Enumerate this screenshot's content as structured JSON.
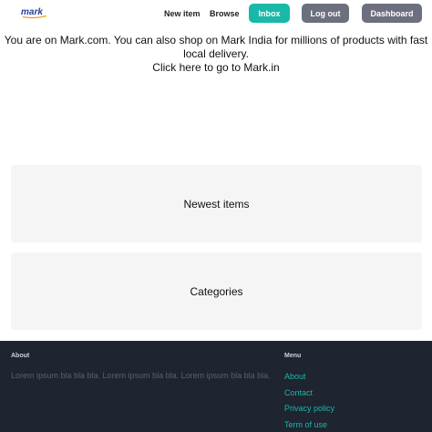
{
  "header": {
    "logo_text": "mark",
    "nav": {
      "new_item": "New item",
      "browse": "Browse"
    },
    "buttons": {
      "inbox": "Inbox",
      "logout": "Log out",
      "dashboard": "Dashboard"
    }
  },
  "notice": {
    "line1": "You are on Mark.com. You can also shop on Mark India for millions of products with fast",
    "line2": "local delivery.",
    "link": "Click here to go to Mark.in"
  },
  "sections": {
    "newest": "Newest items",
    "categories": "Categories"
  },
  "footer": {
    "about_heading": "About",
    "about_text": "Lorem ipsum bla bla bla. Lorem ipsum bla bla. Lorem ipsum bla bla bla.",
    "menu_heading": "Menu",
    "menu_items": [
      "About",
      "Contact",
      "Privacy policy",
      "Term of use"
    ]
  },
  "colors": {
    "accent": "#1ab8a8",
    "secondary_button": "#6b6f7e",
    "footer_bg": "#1e2430"
  }
}
